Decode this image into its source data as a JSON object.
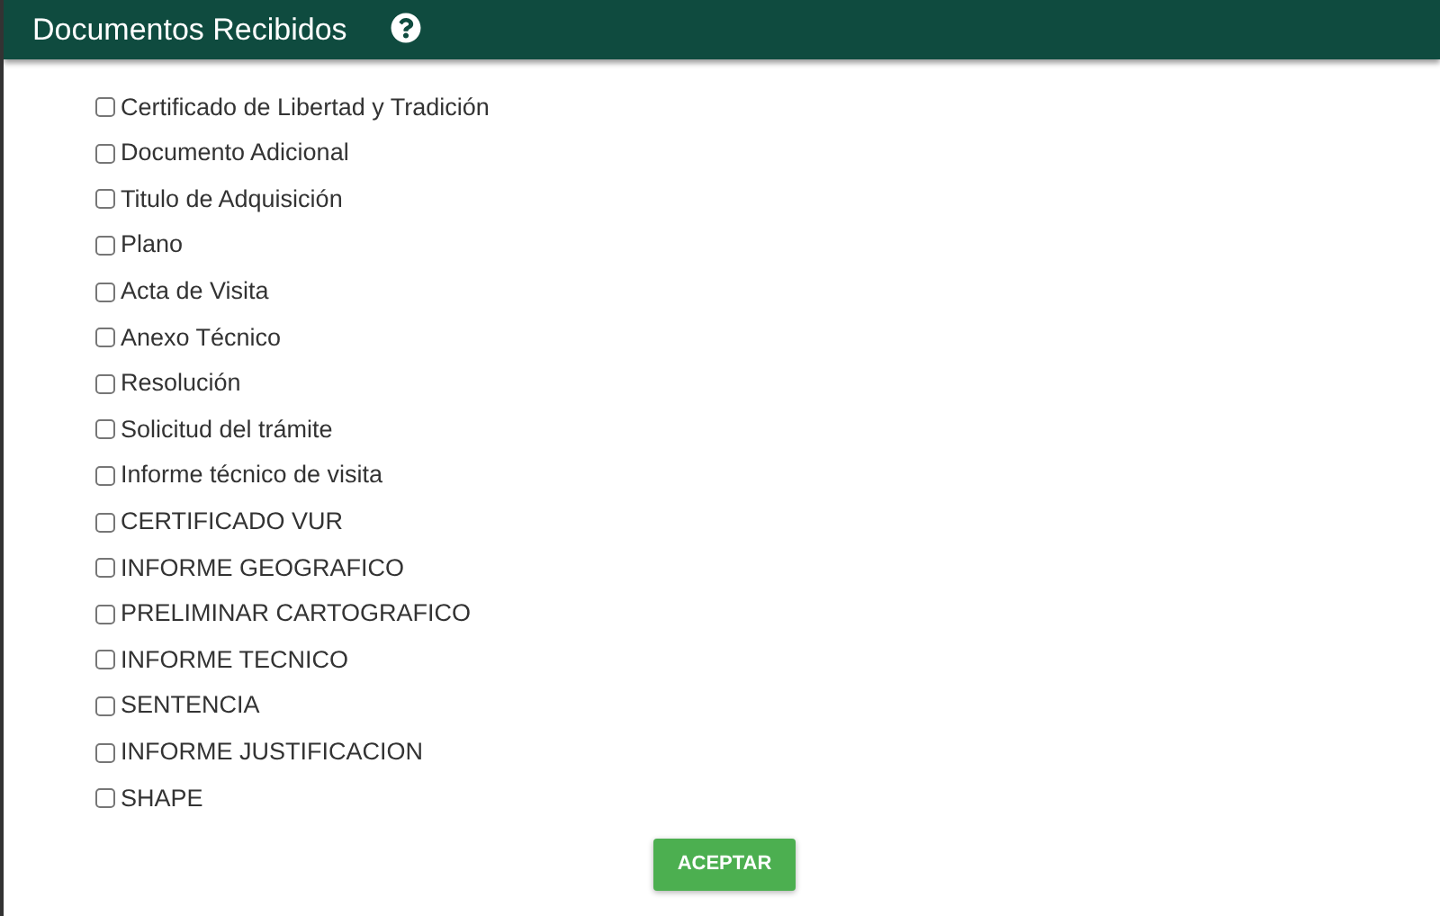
{
  "header": {
    "title": "Documentos Recibidos"
  },
  "documents": [
    {
      "label": "Certificado de Libertad y Tradición",
      "checked": false
    },
    {
      "label": "Documento Adicional",
      "checked": false
    },
    {
      "label": "Titulo de Adquisición",
      "checked": false
    },
    {
      "label": "Plano",
      "checked": false
    },
    {
      "label": "Acta de Visita",
      "checked": false
    },
    {
      "label": "Anexo Técnico",
      "checked": false
    },
    {
      "label": "Resolución",
      "checked": false
    },
    {
      "label": "Solicitud del trámite",
      "checked": false
    },
    {
      "label": "Informe técnico de visita",
      "checked": false
    },
    {
      "label": "CERTIFICADO VUR",
      "checked": false
    },
    {
      "label": "INFORME GEOGRAFICO",
      "checked": false
    },
    {
      "label": "PRELIMINAR CARTOGRAFICO",
      "checked": false
    },
    {
      "label": "INFORME TECNICO",
      "checked": false
    },
    {
      "label": "SENTENCIA",
      "checked": false
    },
    {
      "label": "INFORME JUSTIFICACION",
      "checked": false
    },
    {
      "label": "SHAPE",
      "checked": false
    }
  ],
  "submit_button": "ACEPTAR"
}
